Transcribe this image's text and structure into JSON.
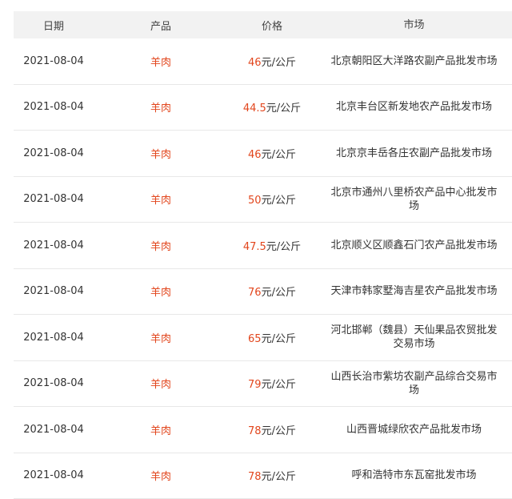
{
  "headers": {
    "date": "日期",
    "product": "产品",
    "price": "价格",
    "market": "市场"
  },
  "colors": {
    "accent": "#e2461d",
    "header_bg": "#f2f2f2",
    "divider": "#e8e8e8"
  },
  "rows": [
    {
      "date": "2021-08-04",
      "product": "羊肉",
      "price": "46",
      "unit": "元/公斤",
      "market": "北京朝阳区大洋路农副产品批发市场"
    },
    {
      "date": "2021-08-04",
      "product": "羊肉",
      "price": "44.5",
      "unit": "元/公斤",
      "market": "北京丰台区新发地农产品批发市场"
    },
    {
      "date": "2021-08-04",
      "product": "羊肉",
      "price": "46",
      "unit": "元/公斤",
      "market": "北京京丰岳各庄农副产品批发市场"
    },
    {
      "date": "2021-08-04",
      "product": "羊肉",
      "price": "50",
      "unit": "元/公斤",
      "market": "北京市通州八里桥农产品中心批发市场"
    },
    {
      "date": "2021-08-04",
      "product": "羊肉",
      "price": "47.5",
      "unit": "元/公斤",
      "market": "北京顺义区顺鑫石门农产品批发市场"
    },
    {
      "date": "2021-08-04",
      "product": "羊肉",
      "price": "76",
      "unit": "元/公斤",
      "market": "天津市韩家墅海吉星农产品批发市场"
    },
    {
      "date": "2021-08-04",
      "product": "羊肉",
      "price": "65",
      "unit": "元/公斤",
      "market": "河北邯郸（魏县）天仙果品农贸批发交易市场"
    },
    {
      "date": "2021-08-04",
      "product": "羊肉",
      "price": "79",
      "unit": "元/公斤",
      "market": "山西长治市紫坊农副产品综合交易市场"
    },
    {
      "date": "2021-08-04",
      "product": "羊肉",
      "price": "78",
      "unit": "元/公斤",
      "market": "山西晋城绿欣农产品批发市场"
    },
    {
      "date": "2021-08-04",
      "product": "羊肉",
      "price": "78",
      "unit": "元/公斤",
      "market": "呼和浩特市东瓦窑批发市场"
    }
  ]
}
